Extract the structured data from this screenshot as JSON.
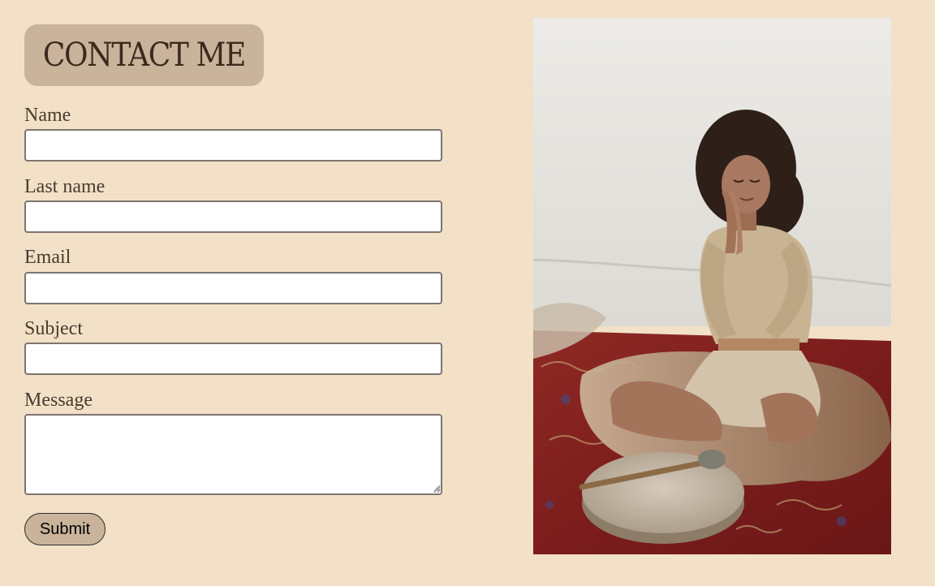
{
  "page": {
    "title": "CONTACT ME"
  },
  "form": {
    "fields": [
      {
        "label": "Name",
        "value": "",
        "placeholder": ""
      },
      {
        "label": "Last name",
        "value": "",
        "placeholder": ""
      },
      {
        "label": "Email",
        "value": "",
        "placeholder": ""
      },
      {
        "label": "Subject",
        "value": "",
        "placeholder": ""
      },
      {
        "label": "Message",
        "value": "",
        "placeholder": ""
      }
    ],
    "submit_label": "Submit"
  },
  "photo": {
    "subject": "woman-meditating-with-frame-drum",
    "icon": "photo-image"
  },
  "colors": {
    "background": "#f2e1c7",
    "title_badge": "#c9b49b",
    "title_text": "#3b2a1d",
    "label_text": "#4a3a2e",
    "input_border": "#7d7570",
    "button_fill": "#c9b49b"
  }
}
